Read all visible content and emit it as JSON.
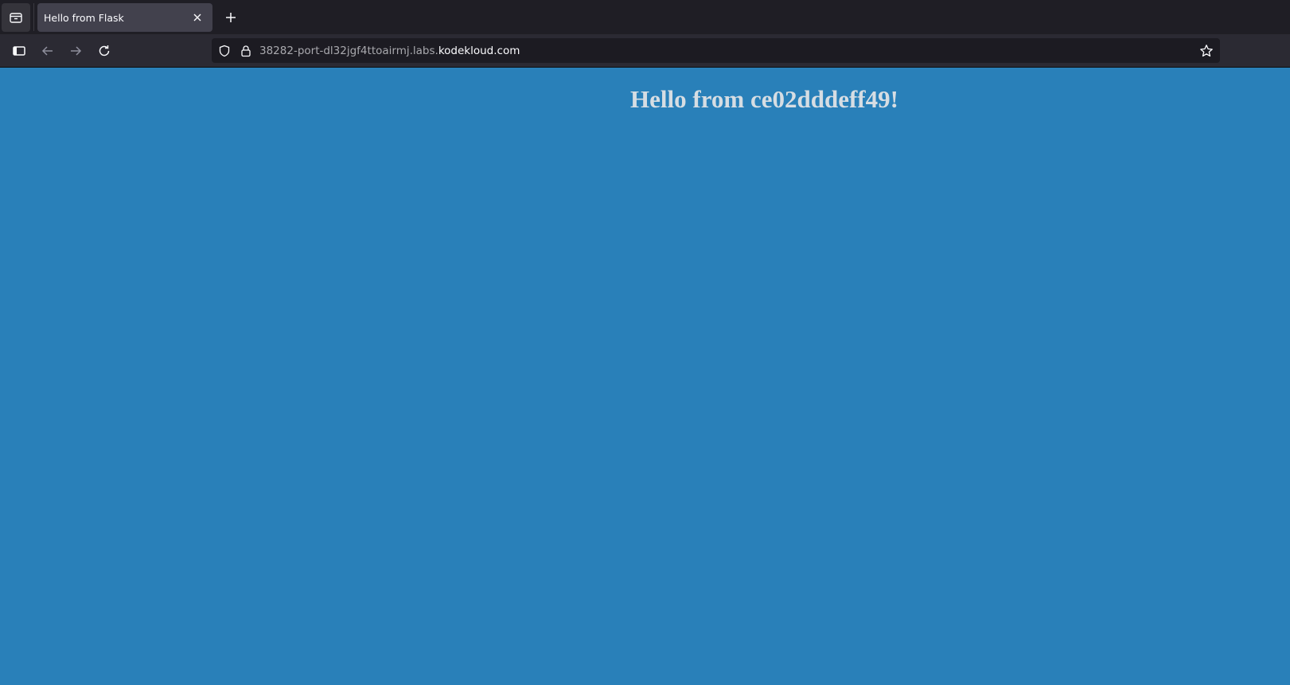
{
  "browser": {
    "tab": {
      "title": "Hello from Flask",
      "close_icon": "close-icon"
    },
    "tab_list_icon": "tab-list-icon",
    "new_tab_icon": "plus-icon",
    "nav": {
      "sidebar_icon": "sidebar-icon",
      "back_icon": "arrow-left-icon",
      "forward_icon": "arrow-right-icon",
      "reload_icon": "reload-icon"
    },
    "urlbar": {
      "subdomain": "38282-port-dl32jgf4ttoairmj.labs.",
      "domain": "kodekloud.com",
      "shield_icon": "shield-icon",
      "lock_icon": "lock-icon",
      "bookmark_icon": "star-icon"
    }
  },
  "page": {
    "heading": "Hello from ce02dddeff49!",
    "background_color": "#2980b9",
    "text_color": "#d6dde3"
  }
}
